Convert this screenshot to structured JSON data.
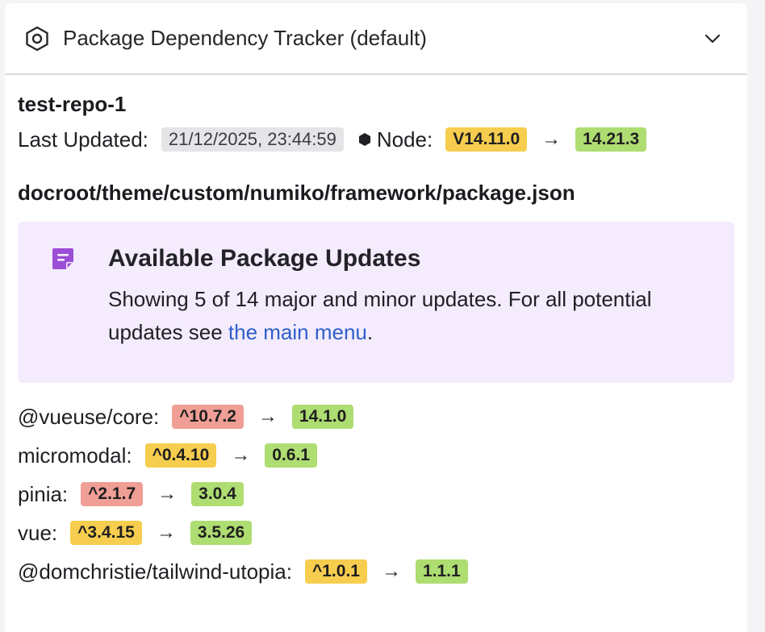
{
  "header": {
    "title": "Package Dependency Tracker (default)",
    "icon": "hexagon-settings-icon",
    "toggle_icon": "chevron-down-icon"
  },
  "repo": {
    "name": "test-repo-1",
    "last_updated_label": "Last Updated:",
    "last_updated_value": "21/12/2025, 23:44:59",
    "node_label": "Node:",
    "node_current": "V14.11.0",
    "node_latest": "14.21.3",
    "arrow": "→"
  },
  "file": {
    "path": "docroot/theme/custom/numiko/framework/package.json"
  },
  "notice": {
    "icon": "note-icon",
    "title": "Available Package Updates",
    "text_before": "Showing 5 of 14 major and minor updates. For all potential updates see ",
    "link_text": "the main menu",
    "text_after": "."
  },
  "packages": [
    {
      "name": "@vueuse/core:",
      "current": "^10.7.2",
      "current_level": "major",
      "latest": "14.1.0"
    },
    {
      "name": "micromodal:",
      "current": "^0.4.10",
      "current_level": "minor",
      "latest": "0.6.1"
    },
    {
      "name": "pinia:",
      "current": "^2.1.7",
      "current_level": "major",
      "latest": "3.0.4"
    },
    {
      "name": "vue:",
      "current": "^3.4.15",
      "current_level": "minor",
      "latest": "3.5.26"
    },
    {
      "name": "@domchristie/tailwind-utopia:",
      "current": "^1.0.1",
      "current_level": "minor",
      "latest": "1.1.1"
    }
  ],
  "colors": {
    "major": "#ef9f95",
    "minor": "#f6cd4e",
    "latest": "#aedd72",
    "notice_bg": "#f4ecfd",
    "link": "#2e5fc9",
    "notice_icon": "#9b4fd6"
  }
}
